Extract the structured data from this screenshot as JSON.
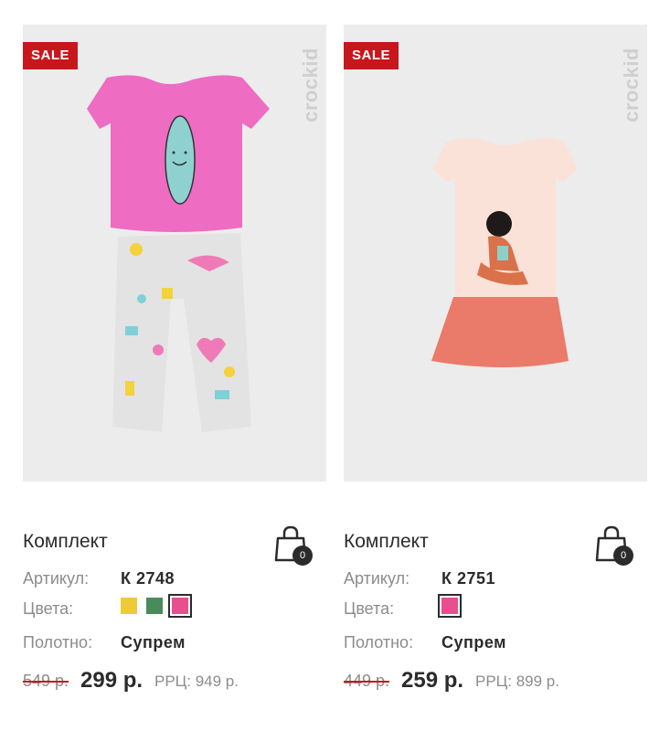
{
  "products": [
    {
      "badge": "SALE",
      "brand": "crockid",
      "name": "Комплект",
      "article_label": "Артикул:",
      "article": "К 2748",
      "colors_label": "Цвета:",
      "colors": [
        "#f0c93a",
        "#4a8b5c",
        "#e74f8e"
      ],
      "selected_color": "#e74f8e",
      "fabric_label": "Полотно:",
      "fabric": "Супрем",
      "old_price": "549 р.",
      "price": "299 р.",
      "rrc": "РРЦ: 949 р.",
      "cart_count": "0"
    },
    {
      "badge": "SALE",
      "brand": "crockid",
      "name": "Комплект",
      "article_label": "Артикул:",
      "article": "К 2751",
      "colors_label": "Цвета:",
      "colors": [
        "#e74f8e"
      ],
      "selected_color": "#e74f8e",
      "fabric_label": "Полотно:",
      "fabric": "Супрем",
      "old_price": "449 р.",
      "price": "259 р.",
      "rrc": "РРЦ: 899 р.",
      "cart_count": "0"
    }
  ],
  "colors": {
    "sale": "#c8161d",
    "photo_bg": "#ececec",
    "text": "#2b2b2b",
    "muted": "#8c8c8c"
  }
}
